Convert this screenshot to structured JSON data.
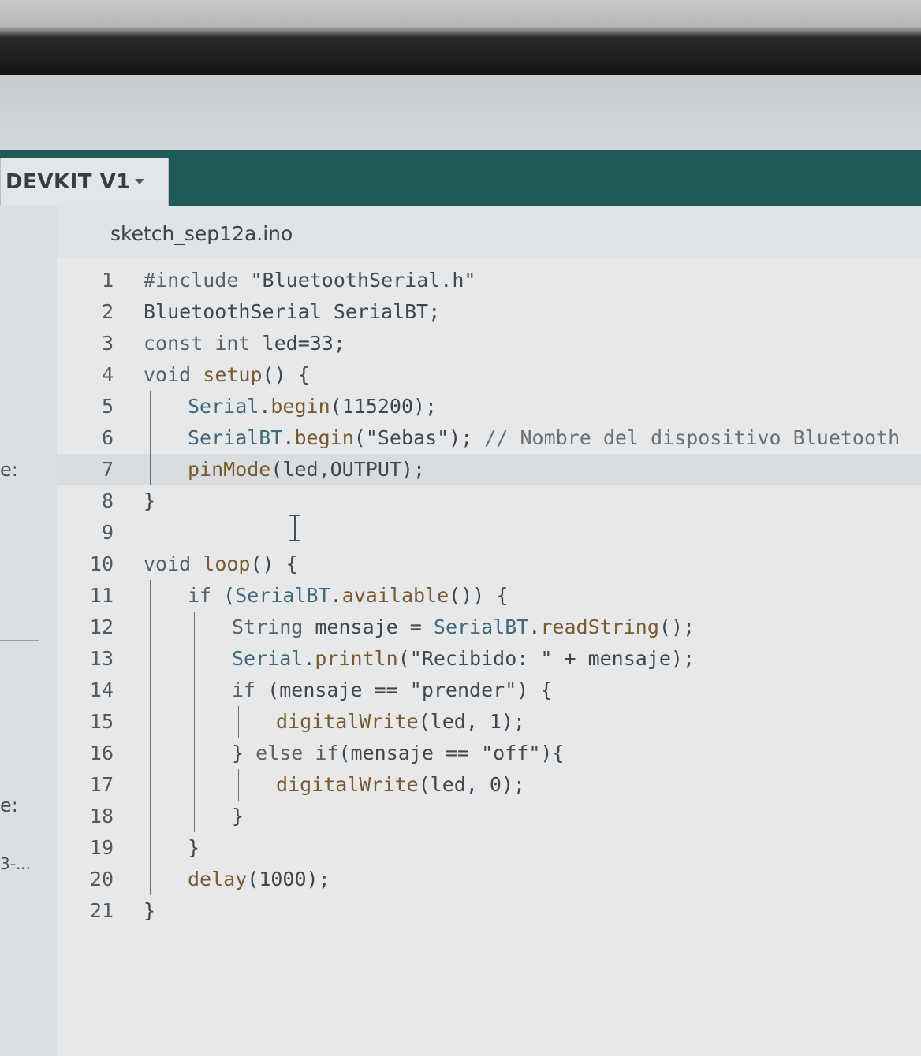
{
  "toolbar": {
    "board": "DEVKIT V1"
  },
  "editor": {
    "file_tab": "sketch_sep12a.ino",
    "lines": [
      {
        "n": "1",
        "indent": 0,
        "text": "#include \"BluetoothSerial.h\""
      },
      {
        "n": "2",
        "indent": 0,
        "text": "BluetoothSerial SerialBT;"
      },
      {
        "n": "3",
        "indent": 0,
        "text": "const int led=33;"
      },
      {
        "n": "4",
        "indent": 0,
        "text": "void setup() {"
      },
      {
        "n": "5",
        "indent": 1,
        "text": "Serial.begin(115200);"
      },
      {
        "n": "6",
        "indent": 1,
        "text": "SerialBT.begin(\"Sebas\"); // Nombre del dispositivo Bluetooth"
      },
      {
        "n": "7",
        "indent": 1,
        "text": "pinMode(led,OUTPUT);"
      },
      {
        "n": "8",
        "indent": 0,
        "text": "}"
      },
      {
        "n": "9",
        "indent": 0,
        "text": ""
      },
      {
        "n": "10",
        "indent": 0,
        "text": "void loop() {"
      },
      {
        "n": "11",
        "indent": 1,
        "text": "if (SerialBT.available()) {"
      },
      {
        "n": "12",
        "indent": 2,
        "text": "String mensaje = SerialBT.readString();"
      },
      {
        "n": "13",
        "indent": 2,
        "text": "Serial.println(\"Recibido: \" + mensaje);"
      },
      {
        "n": "14",
        "indent": 2,
        "text": "if (mensaje == \"prender\") {"
      },
      {
        "n": "15",
        "indent": 3,
        "text": "digitalWrite(led, 1);"
      },
      {
        "n": "16",
        "indent": 2,
        "text": "} else if(mensaje == \"off\"){"
      },
      {
        "n": "17",
        "indent": 3,
        "text": "digitalWrite(led, 0);"
      },
      {
        "n": "18",
        "indent": 2,
        "text": "}"
      },
      {
        "n": "19",
        "indent": 1,
        "text": "}"
      },
      {
        "n": "20",
        "indent": 1,
        "text": "delay(1000);"
      },
      {
        "n": "21",
        "indent": 0,
        "text": "}"
      }
    ],
    "active_line": "7"
  },
  "left_panel": {
    "label_1": "e:",
    "label_2": "e:",
    "label_3": "3-..."
  }
}
